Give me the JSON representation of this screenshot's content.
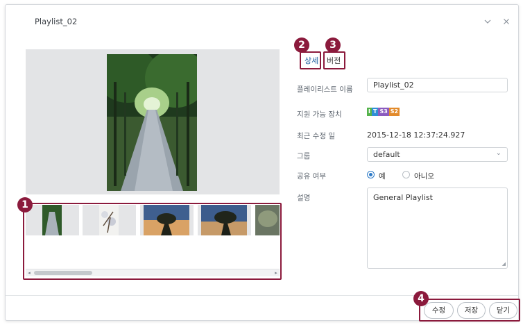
{
  "window": {
    "title": "Playlist_02",
    "minimize_icon": "chevron-down-icon",
    "close_icon": "close-icon"
  },
  "tabs": [
    {
      "label": "상세",
      "active": true
    },
    {
      "label": "버전",
      "active": false
    }
  ],
  "form": {
    "name_label": "플레이리스트 이름",
    "name_value": "Playlist_02",
    "devices_label": "지원 가능 장치",
    "devices": [
      "I",
      "T",
      "S3",
      "S2"
    ],
    "modified_label": "최근 수정 일",
    "modified_value": "2015-12-18 12:37:24.927",
    "group_label": "그룹",
    "group_value": "default",
    "share_label": "공유 여부",
    "share_yes": "예",
    "share_no": "아니오",
    "share_selected": "예",
    "description_label": "설명",
    "description_value": "General Playlist"
  },
  "buttons": {
    "edit": "수정",
    "save": "저장",
    "close": "닫기"
  },
  "callouts": [
    "1",
    "2",
    "3",
    "4"
  ],
  "colors": {
    "callout": "#8b1a3c",
    "accent": "#2c79c6",
    "badge_i": "#55b34c",
    "badge_t": "#2f8fd6",
    "badge_s3": "#8b5bbf",
    "badge_s2": "#e28a2b"
  }
}
